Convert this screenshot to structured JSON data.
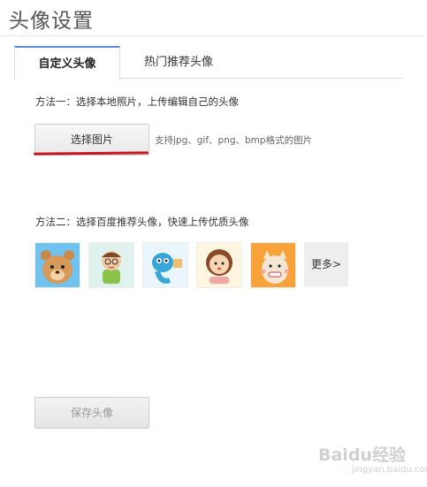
{
  "page": {
    "title": "头像设置"
  },
  "tabs": [
    {
      "label": "自定义头像",
      "active": true
    },
    {
      "label": "热门推荐头像",
      "active": false
    }
  ],
  "method1": {
    "text": "方法一：选择本地照片，上传编辑自己的头像",
    "button": "选择图片",
    "hint": "支持jpg、gif、png、bmp格式的图片"
  },
  "method2": {
    "text": "方法二：选择百度推荐头像，快速上传优质头像",
    "avatars": [
      {
        "icon": "bear-avatar-icon"
      },
      {
        "icon": "boy-glasses-avatar-icon"
      },
      {
        "icon": "dolphin-avatar-icon"
      },
      {
        "icon": "girl-avatar-icon"
      },
      {
        "icon": "cat-avatar-icon"
      }
    ],
    "more": "更多>"
  },
  "save": {
    "label": "保存头像"
  },
  "watermark": {
    "brand": "Baidu经验",
    "url": "jingyan.baidu.com"
  },
  "colors": {
    "tab_accent": "#5b8fd6",
    "underline": "#c8161e"
  }
}
